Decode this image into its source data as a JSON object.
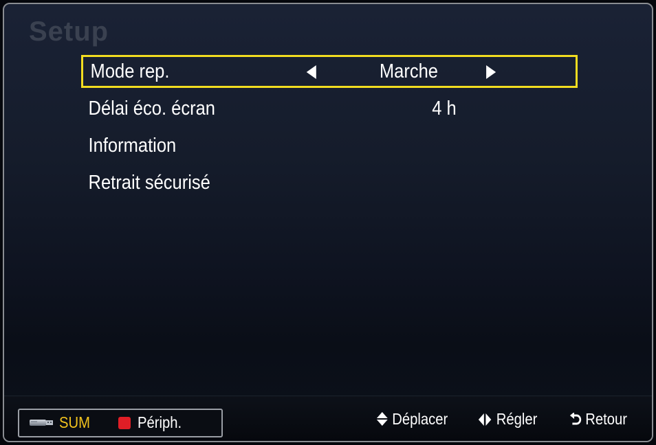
{
  "screen": {
    "title": "Setup"
  },
  "menu": {
    "items": [
      {
        "label": "Mode rep.",
        "value": "Marche",
        "selected": true
      },
      {
        "label": "Délai éco. écran",
        "value": "4 h"
      },
      {
        "label": "Information",
        "value": ""
      },
      {
        "label": "Retrait sécurisé",
        "value": ""
      }
    ]
  },
  "footer": {
    "device_label": "SUM",
    "device_icon": "usb-drive-icon",
    "color_button": {
      "color": "#e01e26",
      "label": "Périph."
    },
    "hints": {
      "move": "Déplacer",
      "adjust": "Régler",
      "return": "Retour"
    }
  },
  "colors": {
    "highlight": "#f2dd20",
    "sum_label": "#f2c31e",
    "red_button": "#e01e26"
  }
}
